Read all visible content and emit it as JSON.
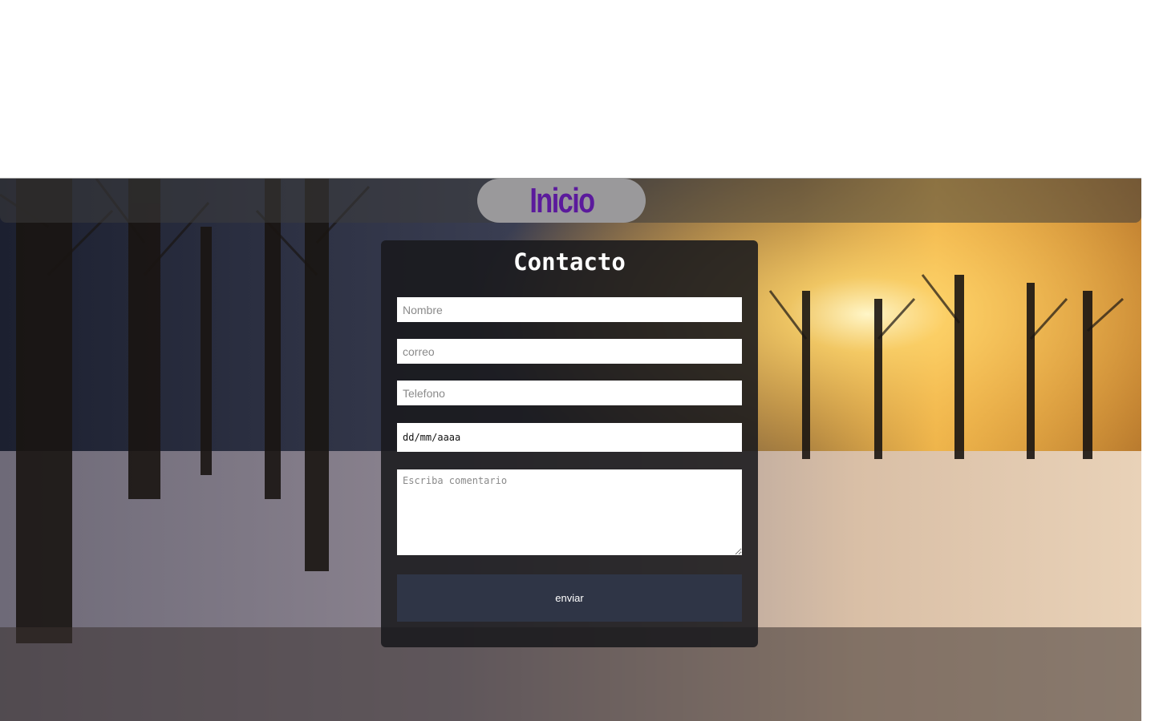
{
  "nav": {
    "home_label": "Inicio"
  },
  "form": {
    "title": "Contacto",
    "name_placeholder": "Nombre",
    "email_placeholder": "correo",
    "phone_placeholder": "Telefono",
    "date_placeholder": "dd/mm/aaaa",
    "comment_placeholder": "Escriba comentario",
    "submit_label": "enviar"
  },
  "colors": {
    "nav_pill": "#9a999b",
    "nav_text": "#5b1a9c",
    "submit_bg": "#2f3546",
    "card_bg": "#19191c"
  },
  "background": {
    "description_icon": "winter-park-sunset-photo"
  }
}
